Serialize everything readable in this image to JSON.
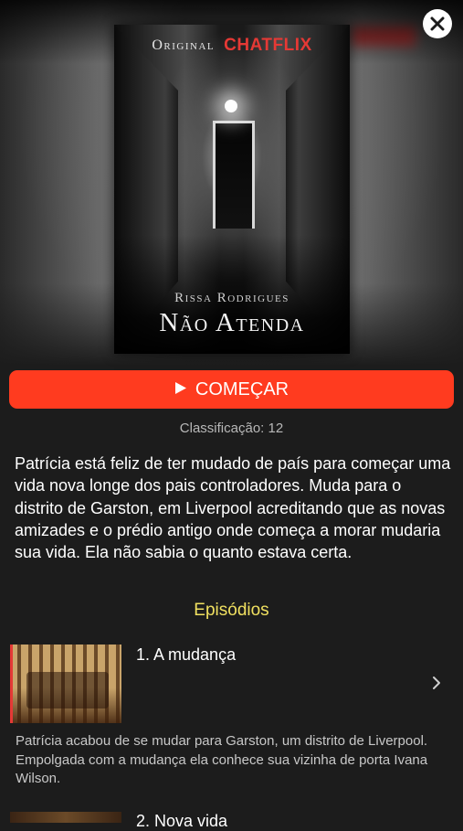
{
  "header": {
    "close_icon": "close-icon"
  },
  "poster": {
    "brand_original": "Original",
    "brand_name": "CHATFLIX",
    "author": "Rissa Rodrigues",
    "title": "Não Atenda",
    "brand_color": "#e53935"
  },
  "actions": {
    "start_label": "COMEÇAR",
    "play_icon": "play-icon",
    "accent_color": "#ff3b1f"
  },
  "details": {
    "rating": "Classificação: 12",
    "synopsis": "Patrícia está feliz de ter mudado de país para começar uma vida nova longe dos pais controladores. Muda para o distrito de Garston, em Liverpool acreditando que as novas amizades e o prédio antigo onde começa a morar mudaria sua vida. Ela não sabia o quanto estava certa."
  },
  "episodes": {
    "heading": "Episódios",
    "heading_color": "#f0e060",
    "items": [
      {
        "title": "1. A mudança",
        "description": "Patrícia acabou de se mudar para Garston, um distrito de Liverpool. Empolgada com a mudança ela conhece sua vizinha de porta Ivana Wilson.",
        "icon": "chevron-right-icon"
      },
      {
        "title": "2. Nova vida"
      }
    ]
  }
}
